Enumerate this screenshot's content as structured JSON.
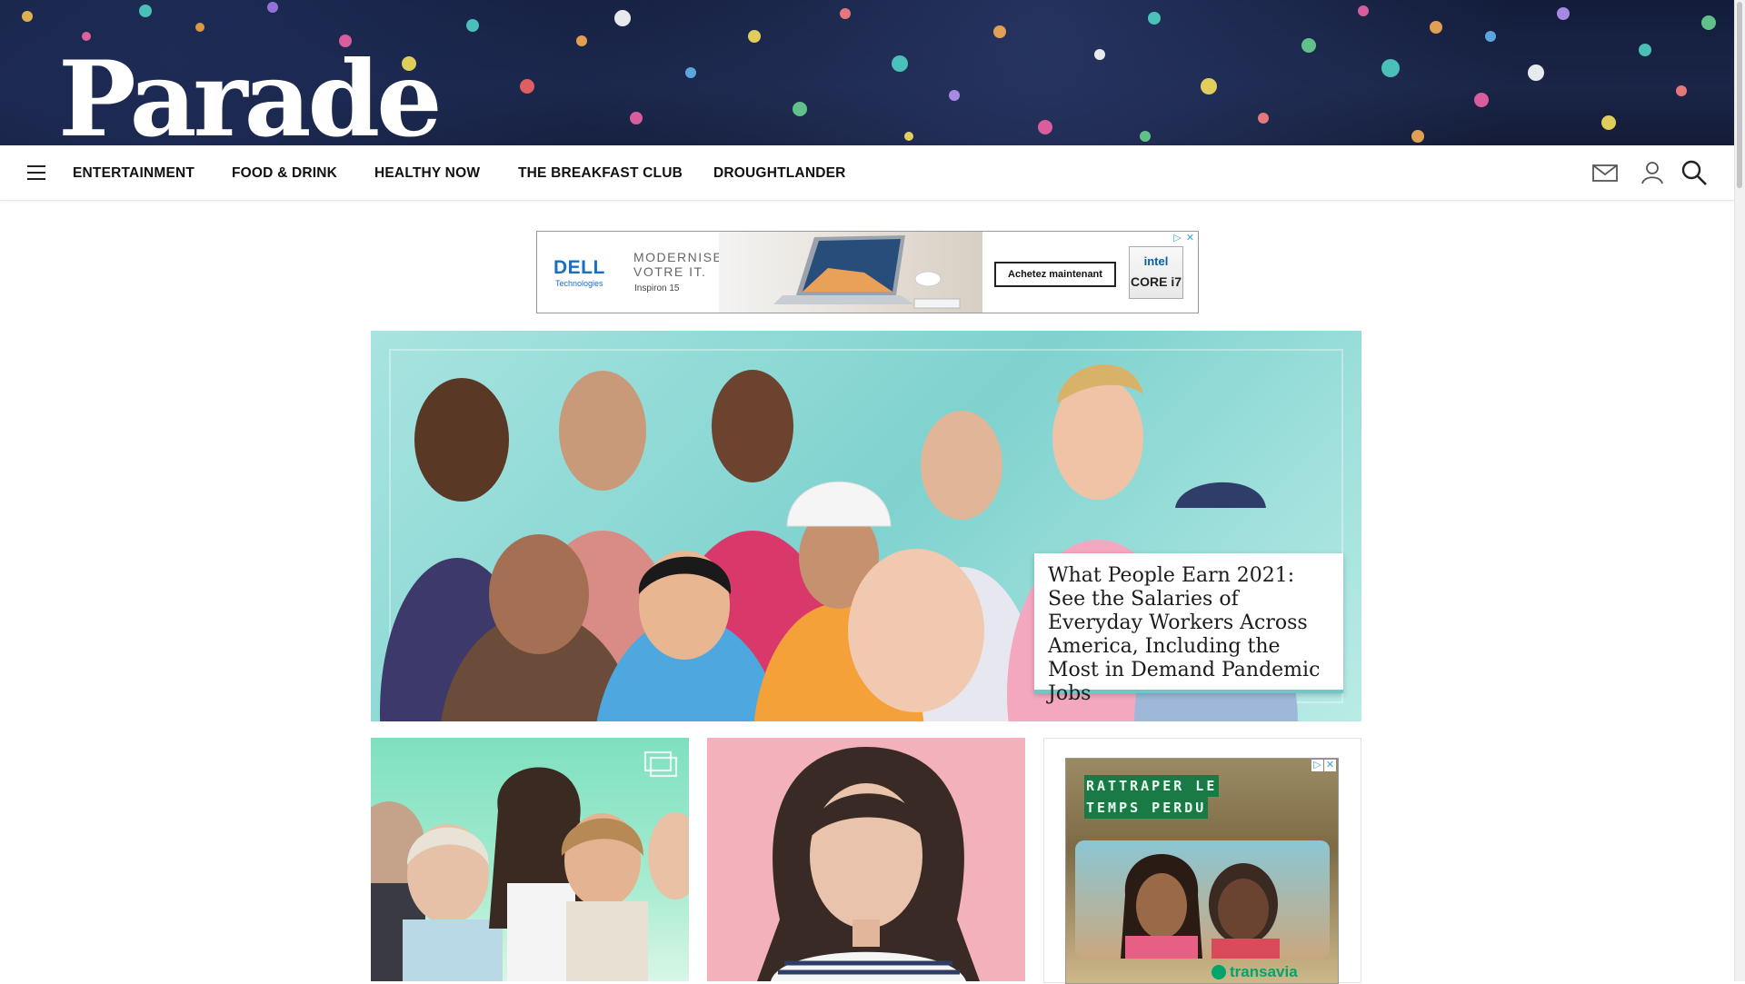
{
  "site": {
    "logo": "Parade"
  },
  "nav": {
    "menu_icon": "hamburger-menu-icon",
    "links": [
      "ENTERTAINMENT",
      "FOOD & DRINK",
      "HEALTHY NOW",
      "THE BREAKFAST CLUB",
      "DROUGHTLANDER"
    ],
    "icons": [
      "mail-icon",
      "user-icon",
      "search-icon"
    ]
  },
  "ad_top": {
    "brand": "DELL",
    "brand_sub": "Technologies",
    "headline_line1": "MODERNISEZ",
    "headline_line2": "VOTRE IT.",
    "product": "Inspiron 15",
    "cta": "Achetez maintenant",
    "badge_top": "intel",
    "badge_bottom": "CORE i7"
  },
  "hero": {
    "headline": "What People Earn 2021: See the Salaries of Everyday Workers Across America, Including the Most in Demand Pandemic Jobs",
    "accent_color": "#6fc7c9"
  },
  "cards": [
    {
      "icon": "gallery-icon"
    },
    {
      "icon": ""
    }
  ],
  "ad_side": {
    "headline_line1": "RATTRAPER LE",
    "headline_line2": "TEMPS PERDU",
    "brand": "transavia"
  },
  "colors": {
    "banner": "#141c3a",
    "transavia": "#00a56c",
    "dell": "#1a6fc4"
  }
}
